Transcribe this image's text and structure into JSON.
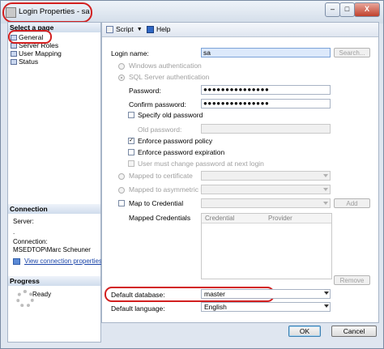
{
  "window": {
    "title": "Login Properties - sa",
    "controls": {
      "minimize": "–",
      "maximize": "□",
      "close": "X"
    }
  },
  "sidebar": {
    "header": "Select a page",
    "pages": [
      "General",
      "Server Roles",
      "User Mapping",
      "Status"
    ],
    "connection": {
      "header": "Connection",
      "server_label": "Server:",
      "server_value": ".",
      "connection_label": "Connection:",
      "connection_value": "MSEDTOP\\Marc Scheuner",
      "view_link": "View connection properties"
    },
    "progress": {
      "header": "Progress",
      "status": "Ready"
    }
  },
  "toolbar": {
    "script_label": "Script",
    "help_label": "Help"
  },
  "form": {
    "login_name_label": "Login name:",
    "login_name_value": "sa",
    "search_button": "Search...",
    "windows_auth": "Windows authentication",
    "sql_auth": "SQL Server authentication",
    "password_label": "Password:",
    "password_value": "●●●●●●●●●●●●●●●",
    "confirm_label": "Confirm password:",
    "confirm_value": "●●●●●●●●●●●●●●●",
    "specify_old": "Specify old password",
    "old_password_label": "Old password:",
    "enforce_policy": "Enforce password policy",
    "enforce_expiration": "Enforce password expiration",
    "must_change": "User must change password at next login",
    "mapped_cert": "Mapped to certificate",
    "mapped_key": "Mapped to asymmetric key",
    "map_credential": "Map to Credential",
    "add_button": "Add",
    "mapped_credentials_label": "Mapped Credentials",
    "grid_headers": [
      "Credential",
      "Provider"
    ],
    "remove_button": "Remove",
    "default_db_label": "Default database:",
    "default_db_value": "master",
    "default_lang_label": "Default language:",
    "default_lang_value": "English",
    "check_mark": "✓"
  },
  "buttons": {
    "ok": "OK",
    "cancel": "Cancel"
  }
}
